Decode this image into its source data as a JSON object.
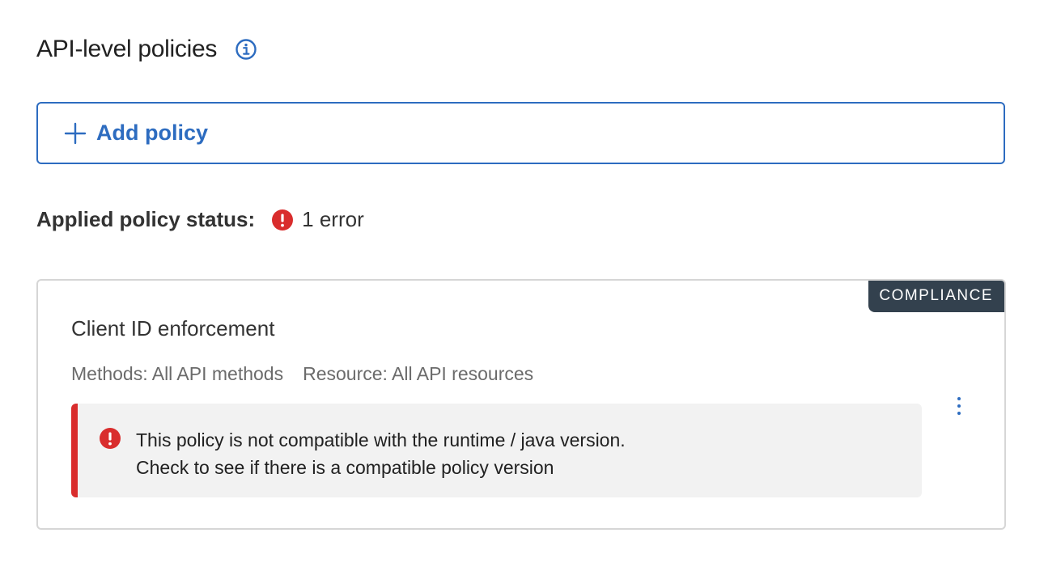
{
  "section": {
    "title": "API-level policies",
    "info_icon": "info-circle-icon"
  },
  "add_policy": {
    "label": "Add policy",
    "icon": "plus-icon"
  },
  "status": {
    "label": "Applied policy status:",
    "value": "1 error",
    "icon": "error-circle-icon",
    "color": "#d92d2d"
  },
  "policy_card": {
    "badge": "COMPLIANCE",
    "title": "Client ID enforcement",
    "methods": "Methods: All API methods",
    "resource": "Resource: All API resources",
    "menu_icon": "more-vertical-icon",
    "alert": {
      "icon": "error-circle-icon",
      "line1": "This policy is not compatible with the runtime / java version.",
      "line2": "Check to see if there is a compatible policy version"
    }
  },
  "colors": {
    "accent": "#2d6cc0",
    "error": "#d92d2d",
    "badge_bg": "#33414e"
  }
}
